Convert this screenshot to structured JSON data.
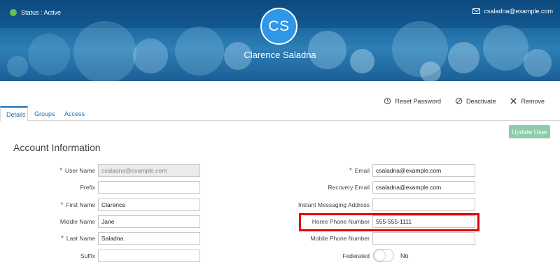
{
  "header": {
    "status": "Status : Active",
    "email": "csaladna@example.com",
    "avatar_initials": "CS",
    "name": "Clarence Saladna",
    "status_color": "#6fc04a",
    "avatar_color": "#2f96e8"
  },
  "actions": {
    "reset_password": "Reset Password",
    "deactivate": "Deactivate",
    "remove": "Remove"
  },
  "tabs": [
    {
      "label": "Details",
      "active": true
    },
    {
      "label": "Groups",
      "active": false
    },
    {
      "label": "Access",
      "active": false
    }
  ],
  "update_button": "Update User",
  "section_title": "Account Information",
  "left_fields": [
    {
      "label": "User Name",
      "required": true,
      "value": "csaladna@example.com",
      "disabled": true
    },
    {
      "label": "Prefix",
      "required": false,
      "value": ""
    },
    {
      "label": "First Name",
      "required": true,
      "value": "Clarence"
    },
    {
      "label": "Middle Name",
      "required": false,
      "value": "Jane"
    },
    {
      "label": "Last Name",
      "required": true,
      "value": "Saladna"
    },
    {
      "label": "Suffix",
      "required": false,
      "value": ""
    }
  ],
  "right_fields": [
    {
      "label": "Email",
      "required": true,
      "value": "csaladna@example.com"
    },
    {
      "label": "Recovery Email",
      "required": false,
      "value": "csaladna@example.com"
    },
    {
      "label": "Instant Messaging Address",
      "required": false,
      "value": ""
    },
    {
      "label": "Home Phone Number",
      "required": false,
      "value": "555-555-1111"
    },
    {
      "label": "Mobile Phone Number",
      "required": false,
      "value": ""
    }
  ],
  "federated": {
    "label": "Federated",
    "value": "No"
  },
  "required_marker": "*"
}
